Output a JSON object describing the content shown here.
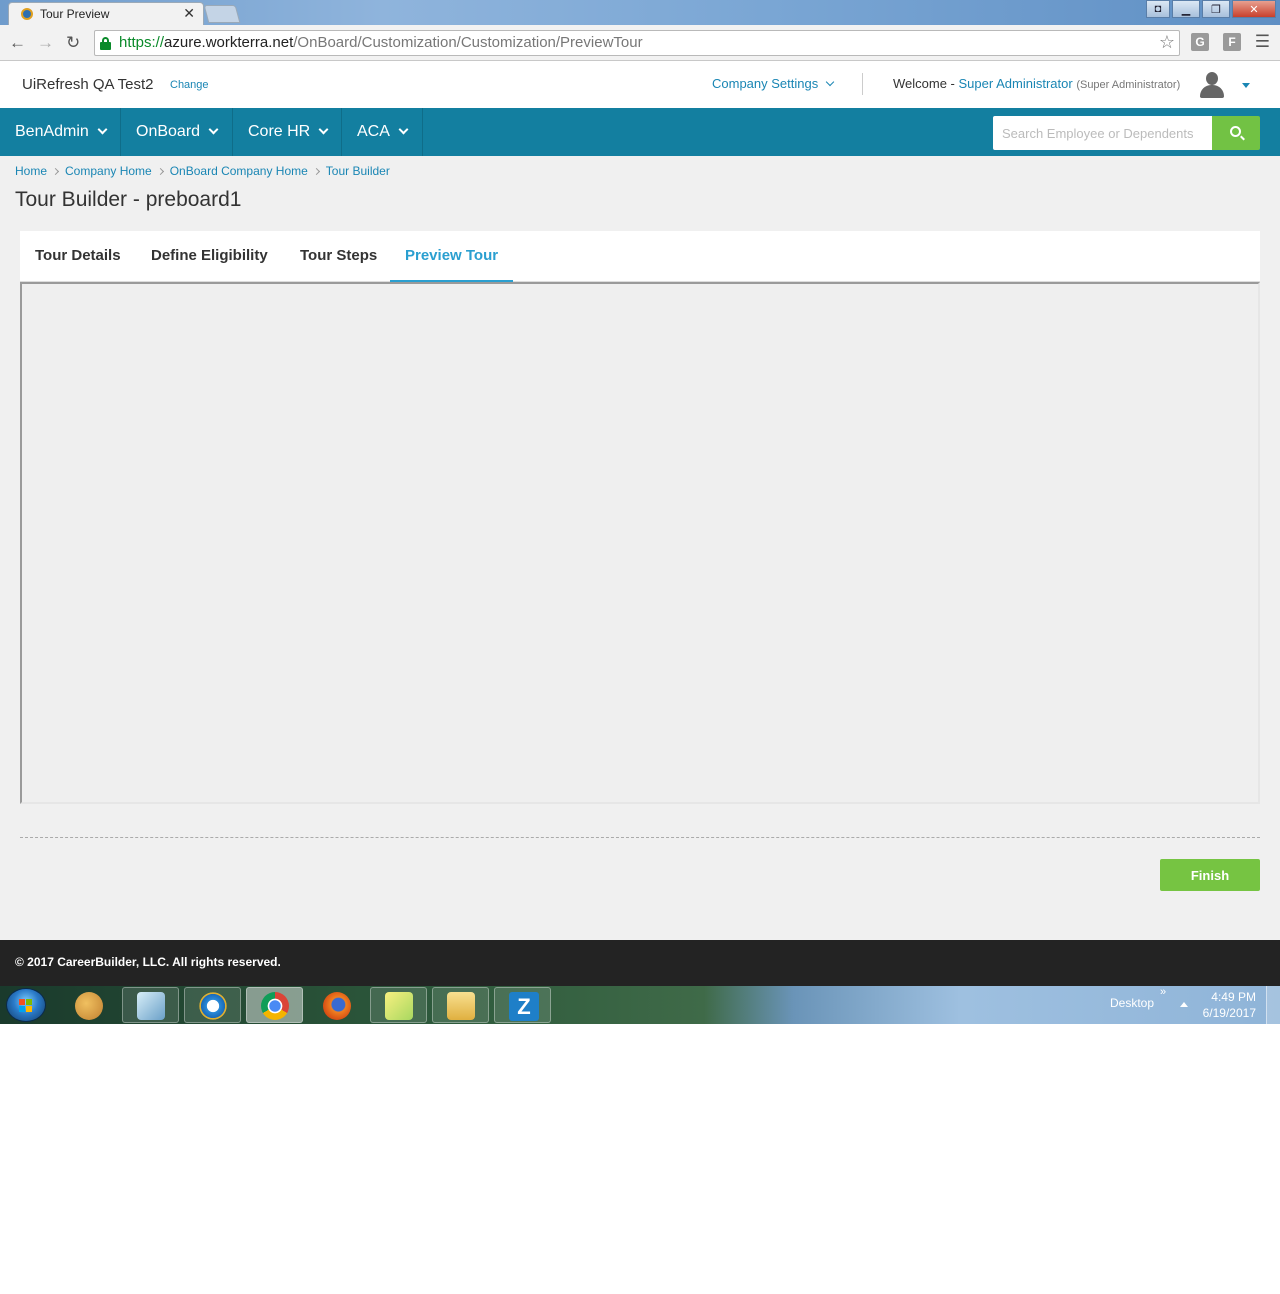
{
  "browser": {
    "tab_title": "Tour Preview",
    "url_scheme": "https://",
    "url_host": "azure.workterra.net",
    "url_path": "/OnBoard/Customization/Customization/PreviewTour",
    "ext1": "G",
    "ext2": "F"
  },
  "header": {
    "company": "UiRefresh QA Test2",
    "change": "Change",
    "company_settings": "Company Settings",
    "welcome": "Welcome -",
    "user_name": "Super Administrator",
    "user_role": "(Super Administrator)"
  },
  "nav": {
    "items": [
      {
        "label": "BenAdmin"
      },
      {
        "label": "OnBoard"
      },
      {
        "label": "Core HR"
      },
      {
        "label": "ACA"
      }
    ],
    "search_placeholder": "Search Employee or Dependents"
  },
  "breadcrumb": [
    "Home",
    "Company Home",
    "OnBoard Company Home",
    "Tour Builder"
  ],
  "page_title": "Tour Builder - preboard1",
  "tabs": [
    {
      "label": "Tour Details",
      "active": false
    },
    {
      "label": "Define Eligibility",
      "active": false
    },
    {
      "label": "Tour Steps",
      "active": false
    },
    {
      "label": "Preview Tour",
      "active": true
    }
  ],
  "finish_label": "Finish",
  "footer": {
    "copyright": "© 2017 CareerBuilder, LLC. All rights reserved."
  },
  "taskbar": {
    "desktop": "Desktop",
    "chevron": "»",
    "time": "4:49 PM",
    "date": "6/19/2017",
    "z_label": "Z"
  },
  "colors": {
    "nav_bg": "#137fa0",
    "accent": "#1a86b4",
    "active_tab": "#2a9fd0",
    "finish": "#76c442",
    "footer_bg": "#232323"
  }
}
